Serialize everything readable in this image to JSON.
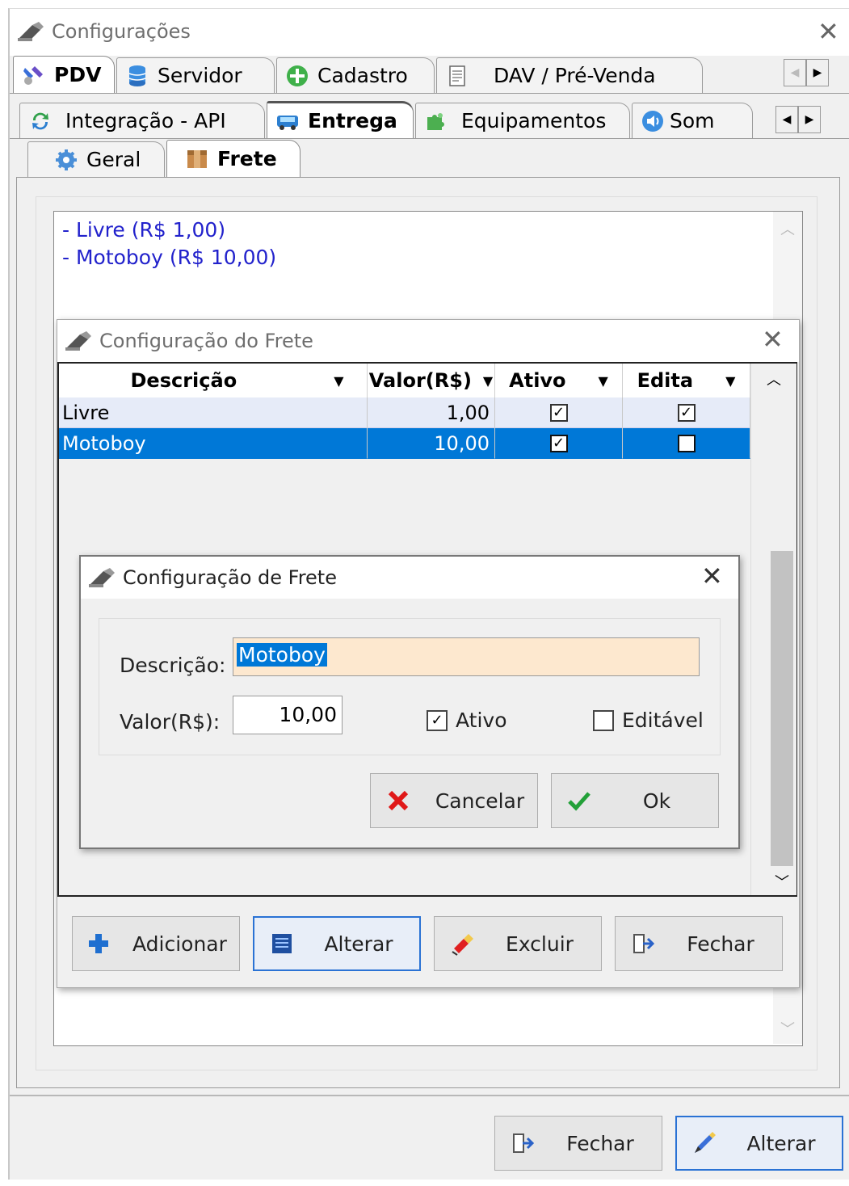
{
  "window": {
    "title": "Configurações"
  },
  "tabs_row1": [
    {
      "label": "PDV",
      "icon": "tools-icon",
      "active": true
    },
    {
      "label": "Servidor",
      "icon": "database-icon"
    },
    {
      "label": "Cadastro",
      "icon": "plus-circle-icon"
    },
    {
      "label": "DAV / Pré-Venda",
      "icon": "document-icon"
    }
  ],
  "tabs_row2": [
    {
      "label": "Integração - API",
      "icon": "refresh-icon"
    },
    {
      "label": "Entrega",
      "icon": "truck-icon",
      "active": true
    },
    {
      "label": "Equipamentos",
      "icon": "puzzle-icon"
    },
    {
      "label": "Som",
      "icon": "speaker-icon"
    }
  ],
  "tabs_row3": [
    {
      "label": "Geral",
      "icon": "gear-icon"
    },
    {
      "label": "Frete",
      "icon": "box-icon",
      "active": true
    }
  ],
  "freight_list": [
    "- Livre (R$ 1,00)",
    "- Motoboy (R$ 10,00)"
  ],
  "grid_dialog": {
    "title": "Configuração do Frete",
    "columns": [
      "Descrição",
      "Valor(R$)",
      "Ativo",
      "Edita"
    ],
    "rows": [
      {
        "descricao": "Livre",
        "valor": "1,00",
        "ativo": true,
        "edita": true,
        "selected": false
      },
      {
        "descricao": "Motoboy",
        "valor": "10,00",
        "ativo": true,
        "edita": false,
        "selected": true
      }
    ],
    "buttons": {
      "add": "Adicionar",
      "edit": "Alterar",
      "delete": "Excluir",
      "close": "Fechar"
    }
  },
  "edit_dialog": {
    "title": "Configuração de Frete",
    "descricao_label": "Descrição:",
    "descricao_value": "Motoboy",
    "valor_label": "Valor(R$):",
    "valor_value": "10,00",
    "ativo_label": "Ativo",
    "ativo_checked": true,
    "editavel_label": "Editável",
    "editavel_checked": false,
    "cancel_label": "Cancelar",
    "ok_label": "Ok"
  },
  "footer": {
    "close_label": "Fechar",
    "edit_label": "Alterar"
  },
  "colors": {
    "selection": "#0078d7",
    "link_blue": "#2222cc",
    "input_highlight": "#fde8cf",
    "focus_border": "#2a72d4"
  }
}
